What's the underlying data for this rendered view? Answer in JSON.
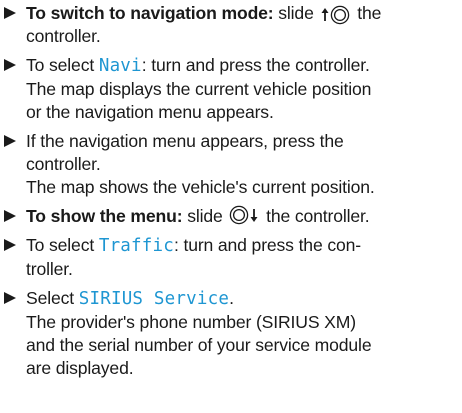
{
  "steps": [
    {
      "bold": "To switch to navigation mode:",
      "before": "slide",
      "after": "the",
      "line2": "controller.",
      "icon": "controller-slide-up-icon"
    },
    {
      "before": "To select ",
      "term": "Navi",
      "after": ": turn and press the controller.",
      "line2": "The map displays the current vehicle position",
      "line3": "or the navigation menu appears."
    },
    {
      "line1": "If the navigation menu appears, press the",
      "line2": "controller.",
      "line3": "The map shows the vehicle's current position."
    },
    {
      "bold": "To show the menu:",
      "before": "slide",
      "after": "the controller.",
      "icon": "controller-slide-down-icon"
    },
    {
      "before": "To select ",
      "term": "Traffic",
      "after": ": turn and press the con-",
      "line2": "troller."
    },
    {
      "before": "Select ",
      "term": "SIRIUS Service",
      "after": ".",
      "line2": "The provider's phone number (SIRIUS XM)",
      "line3": "and the serial number of your service module",
      "line4": "are displayed."
    }
  ],
  "colors": {
    "ui_term": "#1e96d2",
    "text": "#1a1a1a"
  }
}
